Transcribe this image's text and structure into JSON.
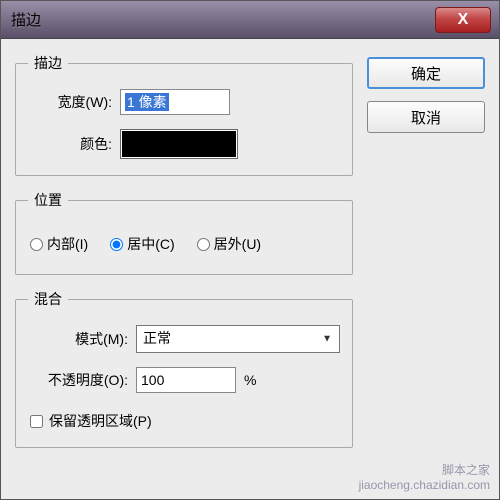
{
  "window": {
    "title": "描边"
  },
  "buttons": {
    "ok": "确定",
    "cancel": "取消",
    "close": "X"
  },
  "stroke": {
    "legend": "描边",
    "width_label": "宽度(W):",
    "width_value": "1 像素",
    "color_label": "颜色:",
    "color_value": "#000000"
  },
  "position": {
    "legend": "位置",
    "inside": "内部(I)",
    "center": "居中(C)",
    "outside": "居外(U)",
    "selected": "center"
  },
  "blend": {
    "legend": "混合",
    "mode_label": "模式(M):",
    "mode_value": "正常",
    "opacity_label": "不透明度(O):",
    "opacity_value": "100",
    "opacity_unit": "%",
    "preserve_label": "保留透明区域(P)",
    "preserve_checked": false
  },
  "watermark": {
    "line1": "脚本之家",
    "line2": "jiaocheng.chazidian.com"
  }
}
